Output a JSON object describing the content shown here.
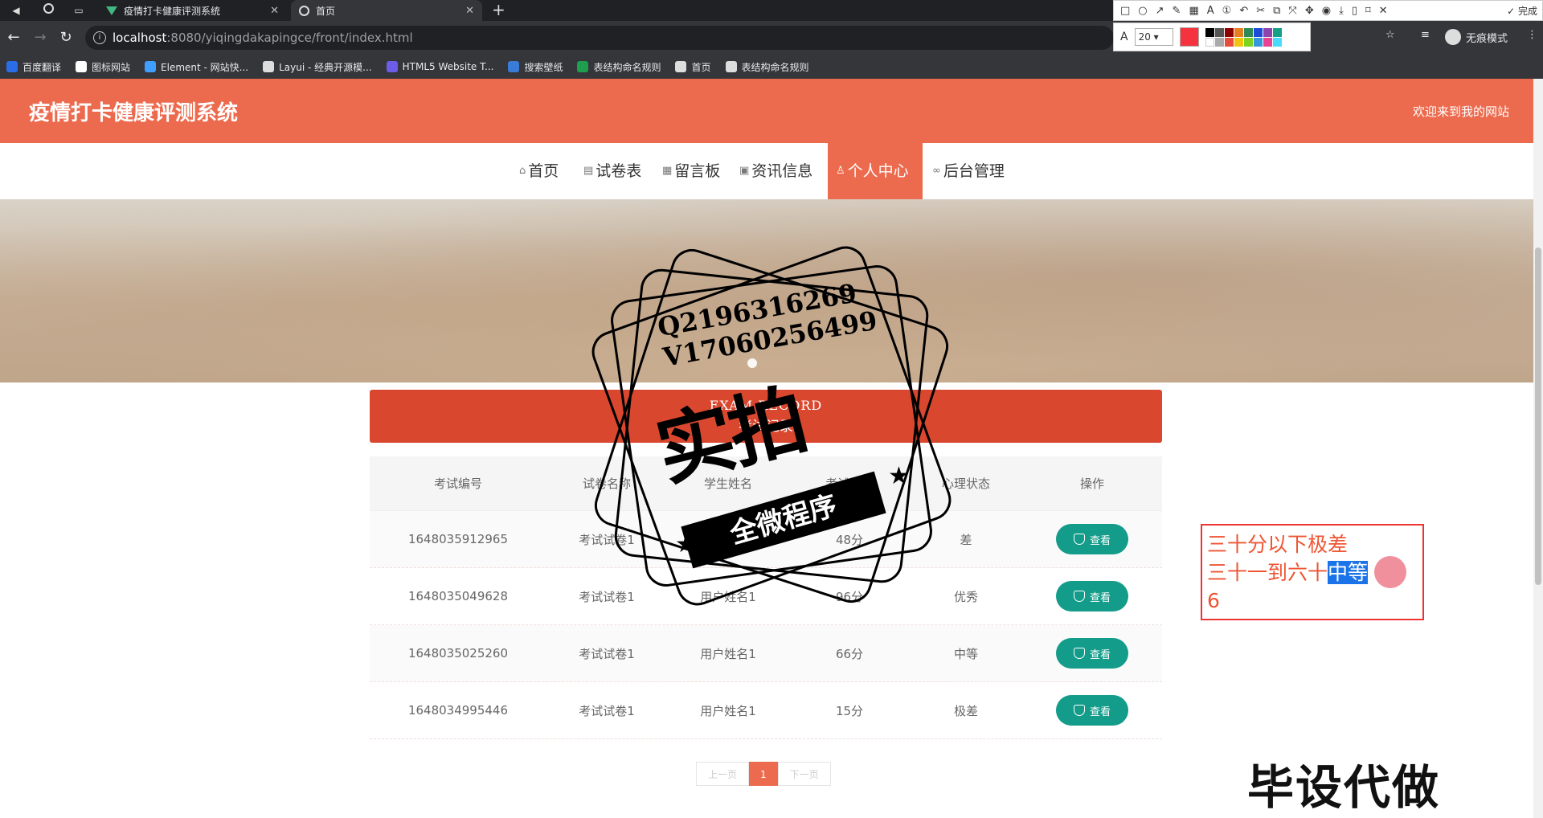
{
  "browser": {
    "tabs": [
      {
        "title": "疫情打卡健康评测系统",
        "icon": "vue-logo-icon",
        "active": false
      },
      {
        "title": "首页",
        "icon": "globe-icon",
        "active": true
      }
    ],
    "url_host": "localhost",
    "url_rest": ":8080/yiqingdakapingce/front/index.html",
    "incognito_label": "无痕模式",
    "bookmarks": [
      {
        "label": "百度翻译",
        "icon": "translate-icon",
        "color": "#2b6de8"
      },
      {
        "label": "图标网站",
        "icon": "flag-icon",
        "color": "#ffffff"
      },
      {
        "label": "Element - 网站快...",
        "icon": "element-icon",
        "color": "#409eff"
      },
      {
        "label": "Layui - 经典开源模...",
        "icon": "layui-icon",
        "color": "#dddddd"
      },
      {
        "label": "HTML5 Website T...",
        "icon": "html5-icon",
        "color": "#6c5ce7"
      },
      {
        "label": "搜索壁纸",
        "icon": "wallpaper-icon",
        "color": "#3b7bd8"
      },
      {
        "label": "表结构命名规则",
        "icon": "sheet-icon",
        "color": "#1e9e4e"
      },
      {
        "label": "首页",
        "icon": "globe-icon",
        "color": "#dddddd"
      },
      {
        "label": "表结构命名规则",
        "icon": "globe-icon",
        "color": "#dddddd"
      }
    ]
  },
  "screenshot_tool": {
    "done_label": "完成",
    "font_size": "20",
    "current_color": "#f5333f"
  },
  "site": {
    "title": "疫情打卡健康评测系统",
    "welcome": "欢迎来到我的网站",
    "nav": [
      {
        "label": "首页",
        "icon": "home-icon"
      },
      {
        "label": "试卷表",
        "icon": "grid-icon"
      },
      {
        "label": "留言板",
        "icon": "grid-icon"
      },
      {
        "label": "资讯信息",
        "icon": "calendar-icon"
      },
      {
        "label": "个人中心",
        "icon": "user-icon",
        "active": true
      },
      {
        "label": "后台管理",
        "icon": "link-icon"
      }
    ]
  },
  "panel": {
    "title_en": "EXAM RECORD",
    "title_cn": "考试记录"
  },
  "table": {
    "headers": [
      "考试编号",
      "试卷名称",
      "学生姓名",
      "考试分数",
      "心理状态",
      "操作"
    ],
    "rows": [
      {
        "id": "1648035912965",
        "paper": "考试试卷1",
        "student": "用户姓名1",
        "score": "48分",
        "status": "差",
        "action": "查看"
      },
      {
        "id": "1648035049628",
        "paper": "考试试卷1",
        "student": "用户姓名1",
        "score": "96分",
        "status": "优秀",
        "action": "查看"
      },
      {
        "id": "1648035025260",
        "paper": "考试试卷1",
        "student": "用户姓名1",
        "score": "66分",
        "status": "中等",
        "action": "查看"
      },
      {
        "id": "1648034995446",
        "paper": "考试试卷1",
        "student": "用户姓名1",
        "score": "15分",
        "status": "极差",
        "action": "查看"
      }
    ]
  },
  "pager": {
    "prev": "上一页",
    "current": "1",
    "next": "下一页"
  },
  "annotation": {
    "line1": "三十分以下极差",
    "line2_prefix": "三十一到六十",
    "line2_selected": "中等",
    "line3": "6"
  },
  "watermark": {
    "qq": "Q2196316269",
    "wechat": "V17060256499",
    "big": "实拍",
    "ribbon": "全微程序",
    "corner": "毕设代做"
  }
}
